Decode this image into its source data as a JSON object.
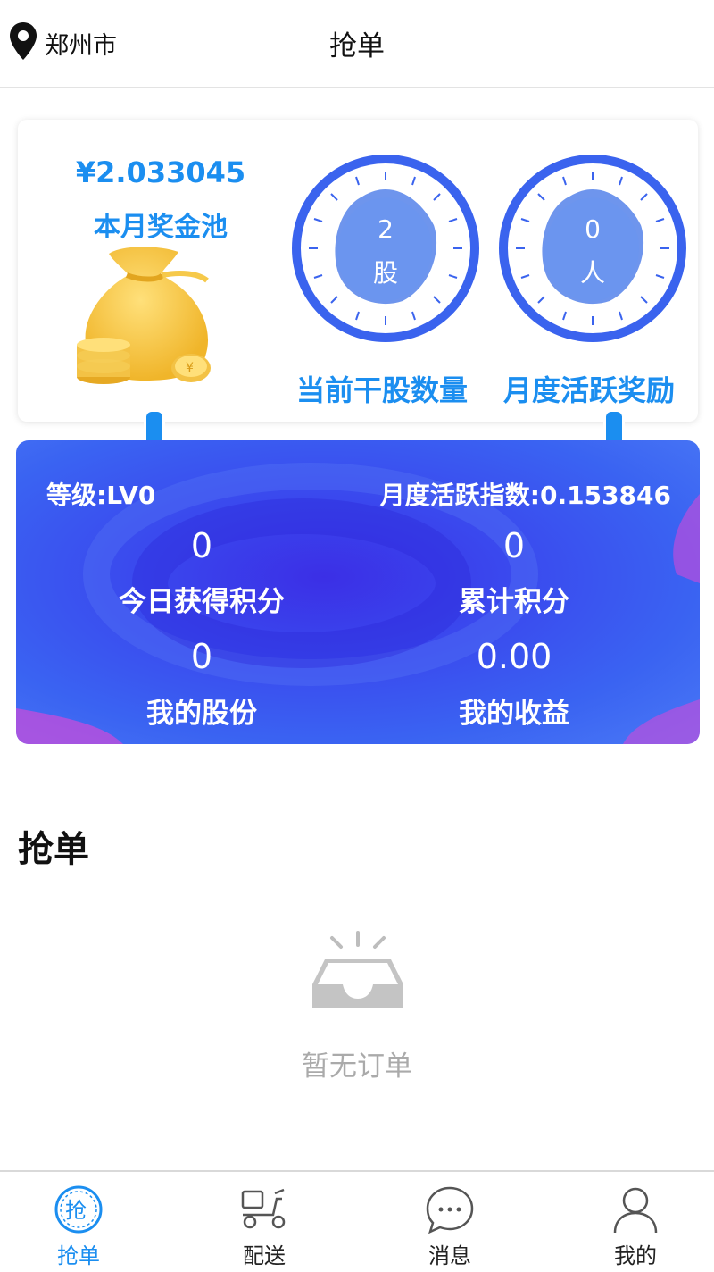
{
  "header": {
    "location": "郑州市",
    "title": "抢单"
  },
  "pool": {
    "amount": "¥2.033045",
    "label": "本月奖金池"
  },
  "dials": [
    {
      "value": "2",
      "unit": "股",
      "caption": "当前干股数量"
    },
    {
      "value": "0",
      "unit": "人",
      "caption": "月度活跃奖励"
    }
  ],
  "stats": {
    "level": "等级:LV0",
    "activity_index": "月度活跃指数:0.153846",
    "today_points": {
      "value": "0",
      "label": "今日获得积分"
    },
    "total_points": {
      "value": "0",
      "label": "累计积分"
    },
    "my_shares": {
      "value": "0",
      "label": "我的股份"
    },
    "my_earnings": {
      "value": "0.00",
      "label": "我的收益"
    }
  },
  "orders": {
    "section_title": "抢单",
    "empty_text": "暂无订单"
  },
  "tabbar": {
    "tabs": [
      {
        "label": "抢单",
        "icon": "grab-order-icon",
        "active": true
      },
      {
        "label": "配送",
        "icon": "scooter-icon",
        "active": false
      },
      {
        "label": "消息",
        "icon": "message-icon",
        "active": false
      },
      {
        "label": "我的",
        "icon": "profile-icon",
        "active": false
      }
    ]
  },
  "colors": {
    "accent": "#1b8ef0",
    "dial_ring": "#3a63ee",
    "stats_bg": "#3a49ee"
  }
}
